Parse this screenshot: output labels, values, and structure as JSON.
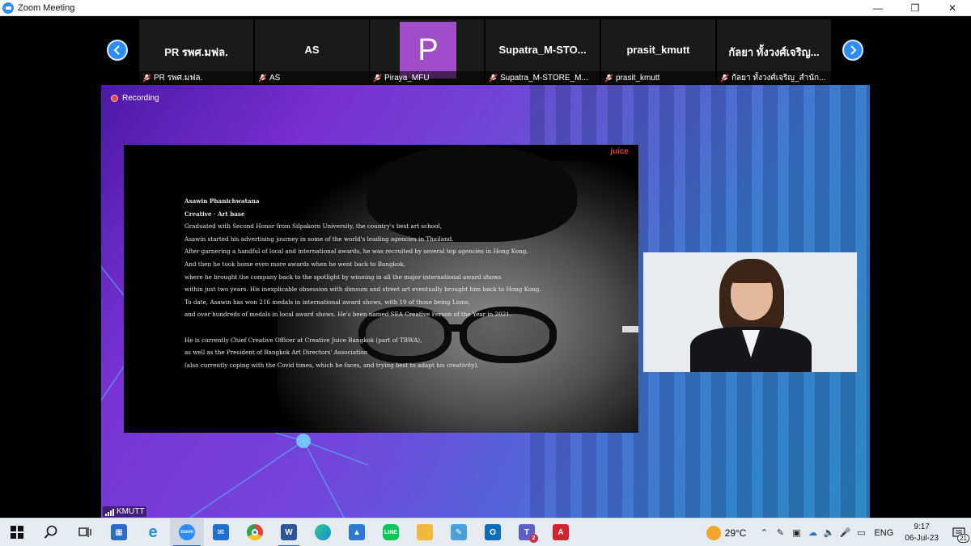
{
  "window": {
    "title": "Zoom Meeting",
    "controls": [
      "minimize-icon",
      "restore-icon",
      "close-icon"
    ]
  },
  "participants": [
    {
      "display_name": "PR รพศ.มฟล.",
      "label": "PR รพศ.มฟล.",
      "muted": true
    },
    {
      "display_name": "AS",
      "label": "AS",
      "muted": true
    },
    {
      "avatar_letter": "P",
      "avatar_color": "#a04dc8",
      "label": "Piraya_MFU",
      "muted": true
    },
    {
      "display_name": "Supatra_M-STO...",
      "label": "Supatra_M-STORE_M...",
      "muted": true
    },
    {
      "display_name": "prasit_kmutt",
      "label": "prasit_kmutt",
      "muted": true
    },
    {
      "display_name": "กัลยา ทั้งวงศ์เจริญ...",
      "label": "กัลยา ทั้งวงศ์เจริญ_สำนัก...",
      "muted": true
    }
  ],
  "recording": {
    "label": "Recording"
  },
  "slide": {
    "logo": "juice",
    "name": "Asawin Phanichwatana",
    "role": "Creative · Art base",
    "paragraph1": [
      "Graduated with Second Honor from Silpakorn University, the country's best art school,",
      "Asawin started his advertising journey in some of the world's leading agencies in Thailand.",
      "After garnering a handful of local and international awards, he was recruited by several top agencies in Hong Kong.",
      "And then he took home even more awards when he went back to Bangkok,",
      "where he brought the company back to the spotlight by winning in all the major international award shows",
      "within just two years. His inexplicable obsession with dimsum and street art eventually brought him back to Hong Kong.",
      "To date, Asawin has won 216 medals in international award shows, with 19 of those being Lions,",
      "and over hundreds of medals in local award shows. He's been named SEA Creative Person of the Year in 2021."
    ],
    "paragraph2": [
      "He is currently Chief Creative Officer at Creative Juice Bangkok (part of TBWA),",
      "as well as the President of Bangkok Art Directors' Association",
      "(also currently coping with the Covid times, which he faces, and trying best to adapt his creativity)."
    ]
  },
  "active_speaker": {
    "name": "KMUTT"
  },
  "taskbar": {
    "apps": [
      {
        "name": "start",
        "color": "#111111"
      },
      {
        "name": "search",
        "color": "#111111"
      },
      {
        "name": "task-view",
        "color": "#111111"
      },
      {
        "name": "store",
        "color": "#2b6cc4"
      },
      {
        "name": "internet-explorer",
        "color": "#1f8fe0"
      },
      {
        "name": "zoom",
        "color": "#2d8cff",
        "active": true
      },
      {
        "name": "mail",
        "color": "#1f6fd1"
      },
      {
        "name": "chrome",
        "color": "#e0432f"
      },
      {
        "name": "word",
        "color": "#2b579a",
        "running": true
      },
      {
        "name": "edge",
        "color": "#1b8ad6"
      },
      {
        "name": "photos",
        "color": "#2a7ad1"
      },
      {
        "name": "line",
        "color": "#06c755"
      },
      {
        "name": "file-explorer",
        "color": "#f1b93c"
      },
      {
        "name": "notepad",
        "color": "#4aa0d8"
      },
      {
        "name": "outlook",
        "color": "#0f6cbd"
      },
      {
        "name": "teams",
        "color": "#5b5fc7",
        "badge": "2"
      },
      {
        "name": "acrobat",
        "color": "#d3232b"
      }
    ],
    "weather": "29°C",
    "language": "ENG",
    "time": "9:17",
    "date": "06-Jul-23",
    "notifications": "21"
  }
}
